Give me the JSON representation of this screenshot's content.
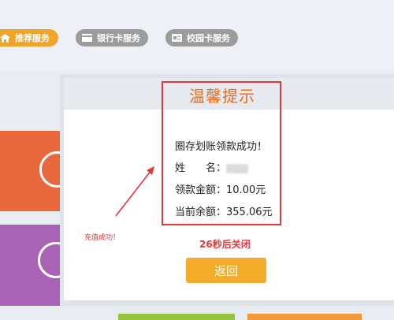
{
  "tabs": [
    {
      "label": "推荐服务",
      "icon": "home-icon",
      "active": true,
      "color": "#f0a52a"
    },
    {
      "label": "银行卡服务",
      "icon": "card-icon",
      "active": false,
      "color": "#9c9c9c"
    },
    {
      "label": "校园卡服务",
      "icon": "id-card-icon",
      "active": false,
      "color": "#9c9c9c"
    }
  ],
  "dialog": {
    "title": "温馨提示",
    "message": "圈存划账领款成功！",
    "name_label": "姓　　名：",
    "amount_label": "领款金额：",
    "amount_value": "10.00元",
    "balance_label": "当前余额：",
    "balance_value": "355.06元",
    "countdown": "26秒后关闭",
    "back_label": "返回"
  },
  "annotation": {
    "text": "充值成功！",
    "color": "#e8333b"
  },
  "colors": {
    "accent": "#f4ad2a",
    "highlight": "#e8333b",
    "title": "#ee6a16"
  }
}
